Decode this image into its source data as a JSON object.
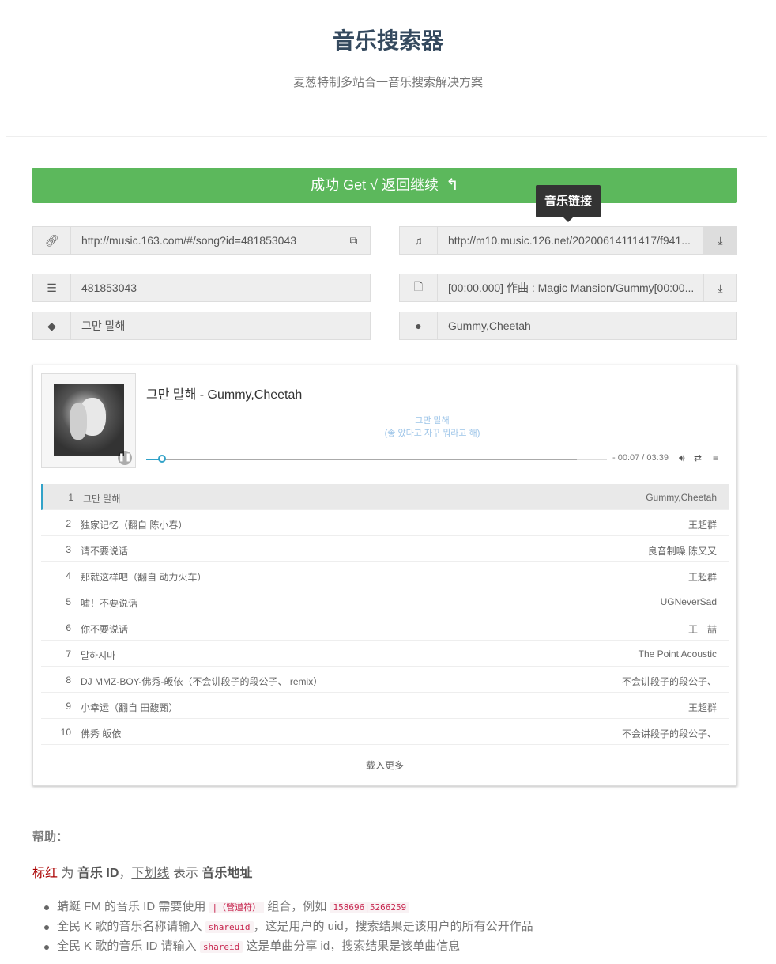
{
  "header": {
    "title": "音乐搜索器",
    "subtitle": "麦葱特制多站合一音乐搜索解决方案"
  },
  "success_button": {
    "label": "成功 Get √ 返回继续",
    "icon": "reply-icon"
  },
  "tooltip": {
    "text": "音乐链接"
  },
  "fields": {
    "song_page_url": "http://music.163.com/#/song?id=481853043",
    "music_url": "http://m10.music.126.net/20200614111417/f941...",
    "music_id": "481853043",
    "lyric": "[00:00.000] 作曲 : Magic Mansion/Gummy[00:00...",
    "song_name": "그만 말해",
    "artist": "Gummy,Cheetah"
  },
  "player": {
    "title": "그만 말해 - Gummy,Cheetah",
    "lyric_line1": "그만 말해",
    "lyric_line2": "(좋 았다고 자꾸 뭐라고 해)",
    "progress": 0.035,
    "time": "- 00:07 / 03:39",
    "playlist": [
      {
        "num": "1",
        "name": "그만 말해",
        "artist": "Gummy,Cheetah"
      },
      {
        "num": "2",
        "name": "独家记忆（翻自 陈小春）",
        "artist": "王超群"
      },
      {
        "num": "3",
        "name": "请不要说话",
        "artist": "良音制噪,陈又又"
      },
      {
        "num": "4",
        "name": "那就这样吧（翻自 动力火车）",
        "artist": "王超群"
      },
      {
        "num": "5",
        "name": "嘘！不要说话",
        "artist": "UGNeverSad"
      },
      {
        "num": "6",
        "name": "你不要说话",
        "artist": "王一喆"
      },
      {
        "num": "7",
        "name": "말하지마",
        "artist": "The Point Acoustic"
      },
      {
        "num": "8",
        "name": "DJ MMZ-BOY-佛秀-皈依（不会讲段子的段公子、 remix）",
        "artist": "不会讲段子的段公子、"
      },
      {
        "num": "9",
        "name": "小幸运（翻自 田馥甄）",
        "artist": "王超群"
      },
      {
        "num": "10",
        "name": "佛秀 皈依",
        "artist": "不会讲段子的段公子、"
      }
    ],
    "load_more": "载入更多"
  },
  "help": {
    "title": "帮助：",
    "legend_red": "标红",
    "legend_for": " 为 ",
    "legend_music_id": "音乐 ID",
    "legend_comma": "，",
    "legend_underline": "下划线",
    "legend_means": " 表示 ",
    "legend_music_url": "音乐地址",
    "bullet1_pre": "蜻蜓 FM 的音乐 ID 需要使用 ",
    "bullet1_code": "|（管道符）",
    "bullet1_mid": " 组合，例如 ",
    "bullet1_example": "158696|5266259",
    "bullet2_pre": "全民 K 歌的音乐名称请输入 ",
    "bullet2_code": "shareuid",
    "bullet2_post": "，这是用户的 uid，搜索结果是该用户的所有公开作品",
    "bullet3_pre": "全民 K 歌的音乐 ID 请输入 ",
    "bullet3_code": "shareid",
    "bullet3_post": " 这是单曲分享 id，搜索结果是该单曲信息"
  }
}
